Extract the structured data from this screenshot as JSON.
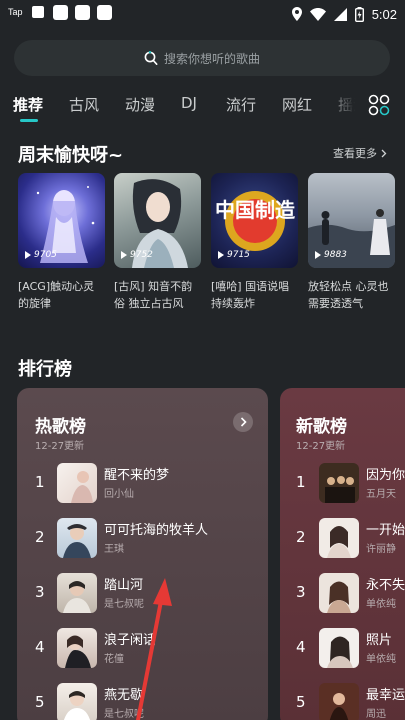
{
  "status_bar": {
    "app_tag": "Tap",
    "time": "5:02"
  },
  "search": {
    "placeholder": "搜索你想听的歌曲"
  },
  "tabs": [
    {
      "label": "推荐",
      "active": true
    },
    {
      "label": "古风",
      "active": false
    },
    {
      "label": "动漫",
      "active": false
    },
    {
      "label": "DJ",
      "active": false
    },
    {
      "label": "流行",
      "active": false
    },
    {
      "label": "网红",
      "active": false
    },
    {
      "label": "摇滚",
      "active": false
    }
  ],
  "weekend_section": {
    "title": "周末愉快呀~",
    "see_more": "查看更多",
    "cards": [
      {
        "plays": "9705",
        "title": "[ACG]触动心灵的旋律"
      },
      {
        "plays": "9752",
        "title": "[古风] 知音不韵俗 独立占古风"
      },
      {
        "plays": "9715",
        "title": "[嘻哈] 国语说唱持续轰炸",
        "cover_text": "中国制造"
      },
      {
        "plays": "9883",
        "title": "放轻松点 心灵也需要透透气"
      }
    ]
  },
  "charts_section": {
    "title": "排行榜",
    "hot": {
      "title": "热歌榜",
      "date": "12-27更新",
      "rows": [
        {
          "rank": "1",
          "song": "醒不来的梦",
          "artist": "回小仙"
        },
        {
          "rank": "2",
          "song": "可可托海的牧羊人",
          "artist": "王琪"
        },
        {
          "rank": "3",
          "song": "踏山河",
          "artist": "是七叔呢"
        },
        {
          "rank": "4",
          "song": "浪子闲话",
          "artist": "花僮"
        },
        {
          "rank": "5",
          "song": "燕无歇",
          "artist": "是七叔呢"
        }
      ]
    },
    "new": {
      "title": "新歌榜",
      "date": "12-27更新",
      "rows": [
        {
          "rank": "1",
          "song": "因为你",
          "artist": "五月天"
        },
        {
          "rank": "2",
          "song": "一开始",
          "artist": "许丽静"
        },
        {
          "rank": "3",
          "song": "永不失",
          "artist": "单依纯"
        },
        {
          "rank": "4",
          "song": "照片",
          "artist": "单依纯"
        },
        {
          "rank": "5",
          "song": "最幸运",
          "artist": "周迅"
        }
      ]
    }
  },
  "colors": {
    "accent": "#27c7c7",
    "background": "#222528",
    "annotation": "#e53935"
  }
}
